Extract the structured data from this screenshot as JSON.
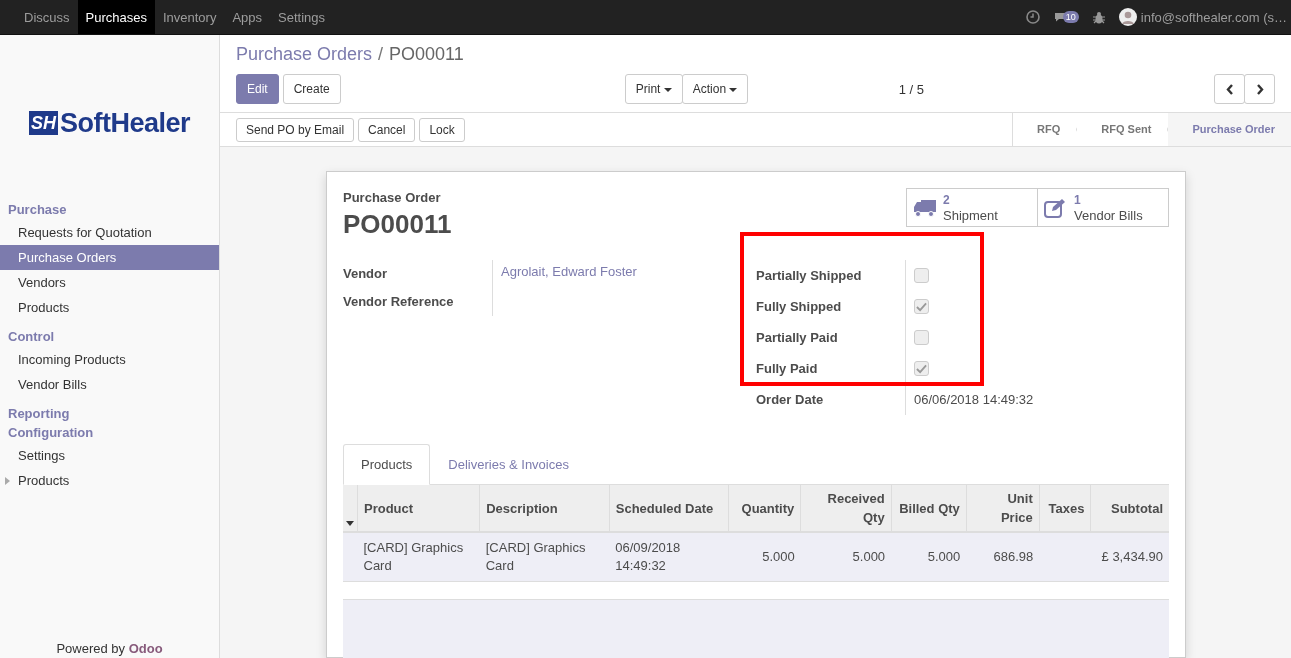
{
  "navbar": {
    "apps": [
      {
        "label": "Discuss",
        "selected": false
      },
      {
        "label": "Purchases",
        "selected": true
      },
      {
        "label": "Inventory",
        "selected": false
      },
      {
        "label": "Apps",
        "selected": false
      },
      {
        "label": "Settings",
        "selected": false
      }
    ],
    "messages_count": "10",
    "user": "info@softhealer.com (s…"
  },
  "sidebar": {
    "logo": {
      "mark": "SH",
      "text": "SoftHealer"
    },
    "sections": [
      {
        "title": "Purchase",
        "items": [
          {
            "label": "Requests for Quotation",
            "selected": false,
            "expandable": false
          },
          {
            "label": "Purchase Orders",
            "selected": true,
            "expandable": false
          },
          {
            "label": "Vendors",
            "selected": false,
            "expandable": false
          },
          {
            "label": "Products",
            "selected": false,
            "expandable": false
          }
        ]
      },
      {
        "title": "Control",
        "items": [
          {
            "label": "Incoming Products",
            "selected": false,
            "expandable": false
          },
          {
            "label": "Vendor Bills",
            "selected": false,
            "expandable": false
          }
        ]
      },
      {
        "title": "Reporting"
      },
      {
        "title": "Configuration",
        "items": [
          {
            "label": "Settings",
            "selected": false,
            "expandable": false
          },
          {
            "label": "Products",
            "selected": false,
            "expandable": true
          }
        ]
      }
    ],
    "footer": {
      "text": "Powered by",
      "brand": "Odoo"
    }
  },
  "breadcrumb": {
    "parent": "Purchase Orders",
    "separator": "/",
    "current": "PO00011"
  },
  "buttons": {
    "edit": "Edit",
    "create": "Create",
    "print": "Print",
    "action": "Action",
    "pager": "1 / 5"
  },
  "status_buttons": [
    "Send PO by Email",
    "Cancel",
    "Lock"
  ],
  "statusbar": [
    {
      "label": "RFQ",
      "selected": false
    },
    {
      "label": "RFQ Sent",
      "selected": false
    },
    {
      "label": "Purchase Order",
      "selected": true
    }
  ],
  "form": {
    "label": "Purchase Order",
    "name": "PO00011",
    "smart_buttons": [
      {
        "kind": "truck",
        "count": "2",
        "label": "Shipment"
      },
      {
        "kind": "edit",
        "count": "1",
        "label": "Vendor Bills"
      }
    ],
    "left_fields": [
      {
        "label": "Vendor",
        "value": "Agrolait, Edward Foster"
      },
      {
        "label": "Vendor Reference"
      }
    ],
    "flags": [
      {
        "label": "Partially Shipped",
        "checked": false
      },
      {
        "label": "Fully Shipped",
        "checked": true
      },
      {
        "label": "Partially Paid",
        "checked": false
      },
      {
        "label": "Fully Paid",
        "checked": true
      }
    ],
    "order_date": {
      "label": "Order Date",
      "value": "06/06/2018 14:49:32"
    },
    "tabs": [
      {
        "label": "Products",
        "selected": true
      },
      {
        "label": "Deliveries & Invoices",
        "selected": false
      }
    ],
    "table": {
      "columns": [
        "Product",
        "Description",
        "Scheduled Date",
        "Quantity",
        "Received Qty",
        "Billed Qty",
        "Unit Price",
        "Taxes",
        "Subtotal"
      ],
      "rows": [
        [
          "[CARD] Graphics Card",
          "[CARD] Graphics Card",
          "06/09/2018 14:49:32",
          "5.000",
          "5.000",
          "5.000",
          "686.98",
          "",
          "£ 3,434.90"
        ]
      ]
    }
  }
}
